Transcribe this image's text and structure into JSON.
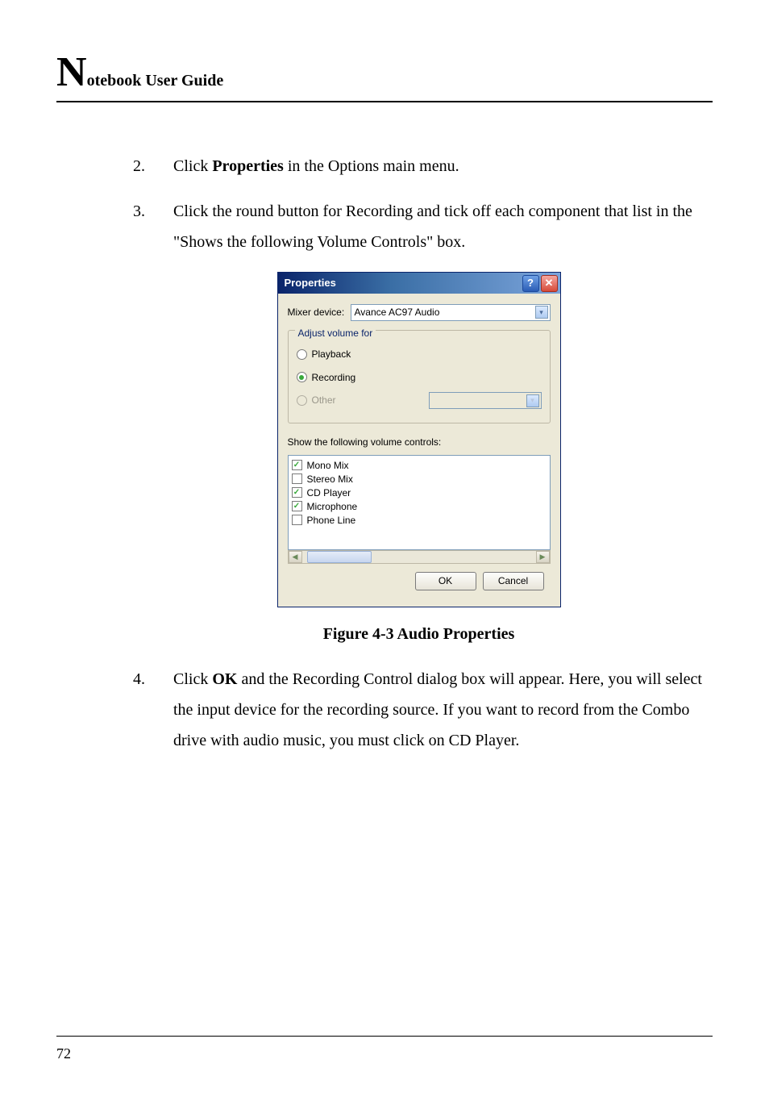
{
  "header": {
    "big": "N",
    "rest": "otebook User Guide"
  },
  "steps": [
    {
      "n": "2.",
      "pre": "Click ",
      "bold": "Properties",
      "post": " in the Options main menu."
    },
    {
      "n": "3.",
      "pre": "Click the round button for Recording and tick off each component that list in the \"Shows the following Volume Controls\" box.",
      "bold": "",
      "post": ""
    },
    {
      "n": "4.",
      "pre": "Click ",
      "bold": "OK",
      "post": " and the Recording Control dialog box will appear. Here, you will select the input device for the recording source. If you want to record from the Combo drive with audio music, you must click on CD Player."
    }
  ],
  "figure_caption": "Figure 4-3  Audio Properties",
  "page_number": "72",
  "dialog": {
    "title": "Properties",
    "help_glyph": "?",
    "close_glyph": "✕",
    "mixer_label": "Mixer device:",
    "mixer_value": "Avance AC97 Audio",
    "group_title": "Adjust volume for",
    "radio_playback": "Playback",
    "radio_recording": "Recording",
    "radio_other": "Other",
    "list_label": "Show the following volume controls:",
    "items": [
      {
        "label": "Mono Mix",
        "checked": true
      },
      {
        "label": "Stereo Mix",
        "checked": false
      },
      {
        "label": "CD Player",
        "checked": true
      },
      {
        "label": "Microphone",
        "checked": true
      },
      {
        "label": "Phone Line",
        "checked": false
      }
    ],
    "ok": "OK",
    "cancel": "Cancel",
    "arrow_down": "▾",
    "arrow_left": "◀",
    "arrow_right": "▶",
    "check_glyph": "✓"
  }
}
